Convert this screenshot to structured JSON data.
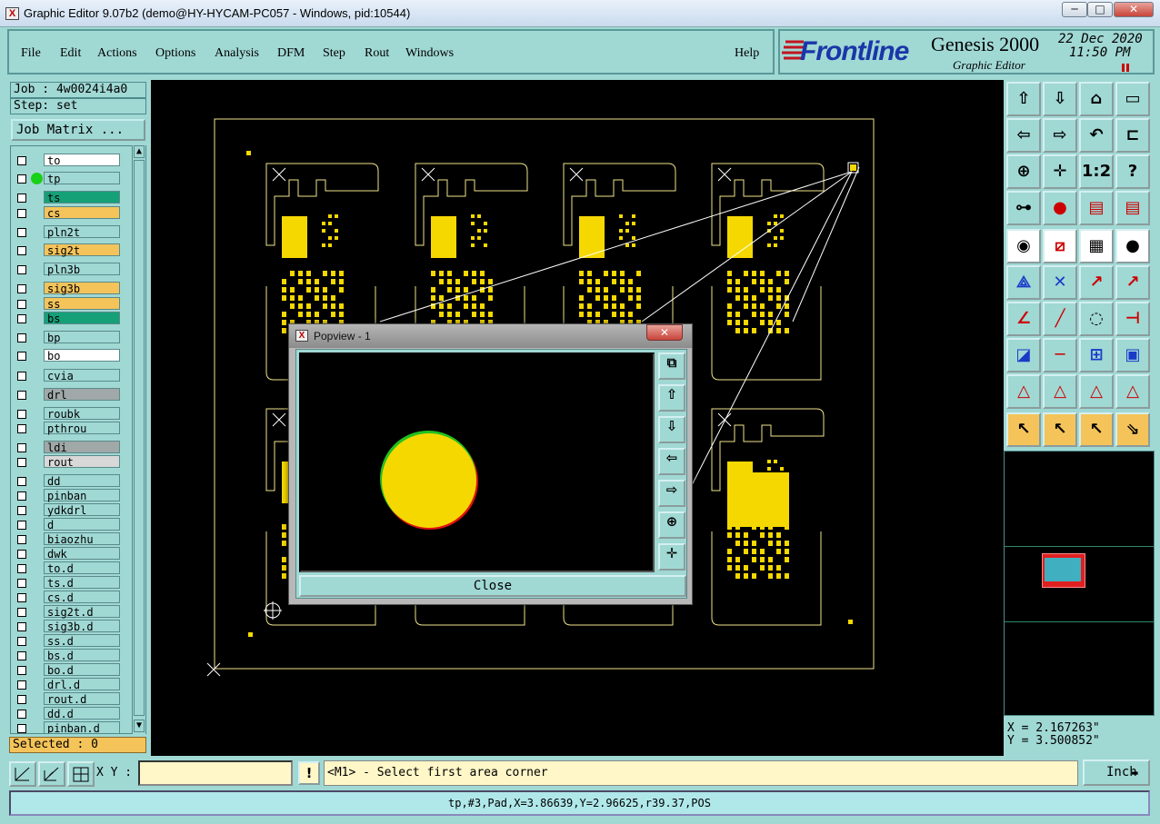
{
  "window": {
    "title": "Graphic Editor 9.07b2 (demo@HY-HYCAM-PC057 - Windows, pid:10544)",
    "controls": {
      "minimize": "─",
      "maximize": "□",
      "close": "✕"
    }
  },
  "menu": {
    "items": [
      "File",
      "Edit",
      "Actions",
      "Options",
      "Analysis",
      "DFM",
      "Step",
      "Rout",
      "Windows"
    ],
    "help": "Help"
  },
  "branding": {
    "logo": "Frontline",
    "product": "Genesis 2000",
    "subtitle": "Graphic Editor",
    "date": "22 Dec 2020",
    "time": "11:50 PM"
  },
  "job": {
    "job_label": "Job : 4w0024i4a0",
    "step_label": "Step: set",
    "matrix_button": "Job Matrix ..."
  },
  "layers": [
    {
      "name": "to",
      "color": "#ffffff"
    },
    {
      "name": "tp",
      "color": "#a0d8d4",
      "active": true
    },
    {
      "name": "ts",
      "color": "#15a078"
    },
    {
      "name": "cs",
      "color": "#f4c35a"
    },
    {
      "name": "pln2t",
      "color": "#a0d8d4"
    },
    {
      "name": "sig2t",
      "color": "#f4c35a"
    },
    {
      "name": "pln3b",
      "color": "#a0d8d4"
    },
    {
      "name": "sig3b",
      "color": "#f4c35a"
    },
    {
      "name": "ss",
      "color": "#f4c35a"
    },
    {
      "name": "bs",
      "color": "#15a078"
    },
    {
      "name": "bp",
      "color": "#a0d8d4"
    },
    {
      "name": "bo",
      "color": "#ffffff"
    },
    {
      "name": "cvia",
      "color": "#a0d8d4"
    },
    {
      "name": "drl",
      "color": "#a0a8a8"
    },
    {
      "name": "roubk",
      "color": "#a0d8d4"
    },
    {
      "name": "pthrou",
      "color": "#a0d8d4"
    },
    {
      "name": "ldi",
      "color": "#a0a8a8"
    },
    {
      "name": "rout",
      "color": "#d8d8d8"
    },
    {
      "name": "dd",
      "color": "#a0d8d4"
    },
    {
      "name": "pinban",
      "color": "#a0d8d4"
    },
    {
      "name": "ydkdrl",
      "color": "#a0d8d4"
    },
    {
      "name": "d",
      "color": "#a0d8d4"
    },
    {
      "name": "biaozhu",
      "color": "#a0d8d4"
    },
    {
      "name": "dwk",
      "color": "#a0d8d4"
    },
    {
      "name": "to.d",
      "color": "#a0d8d4"
    },
    {
      "name": "ts.d",
      "color": "#a0d8d4"
    },
    {
      "name": "cs.d",
      "color": "#a0d8d4"
    },
    {
      "name": "sig2t.d",
      "color": "#a0d8d4"
    },
    {
      "name": "sig3b.d",
      "color": "#a0d8d4"
    },
    {
      "name": "ss.d",
      "color": "#a0d8d4"
    },
    {
      "name": "bs.d",
      "color": "#a0d8d4"
    },
    {
      "name": "bo.d",
      "color": "#a0d8d4"
    },
    {
      "name": "drl.d",
      "color": "#a0d8d4"
    },
    {
      "name": "rout.d",
      "color": "#a0d8d4"
    },
    {
      "name": "dd.d",
      "color": "#a0d8d4"
    },
    {
      "name": "pinban.d",
      "color": "#a0d8d4"
    }
  ],
  "selected": "Selected : 0",
  "coords": {
    "x": "X = 2.167263\"",
    "y": "Y = 3.500852\""
  },
  "bottom": {
    "xy_label": "X Y :",
    "xy_value": "",
    "excl": "!",
    "prompt": "<M1> - Select first area corner",
    "unit": "Inch",
    "status": "tp,#3,Pad,X=3.86639,Y=2.96625,r39.37,POS"
  },
  "popview": {
    "title": "Popview - 1",
    "close_button": "Close",
    "close_x": "✕"
  },
  "colors": {
    "accent": "#a0d8d4",
    "feature": "#f5d800",
    "board": "#000000",
    "outline": "#f0e58a"
  }
}
